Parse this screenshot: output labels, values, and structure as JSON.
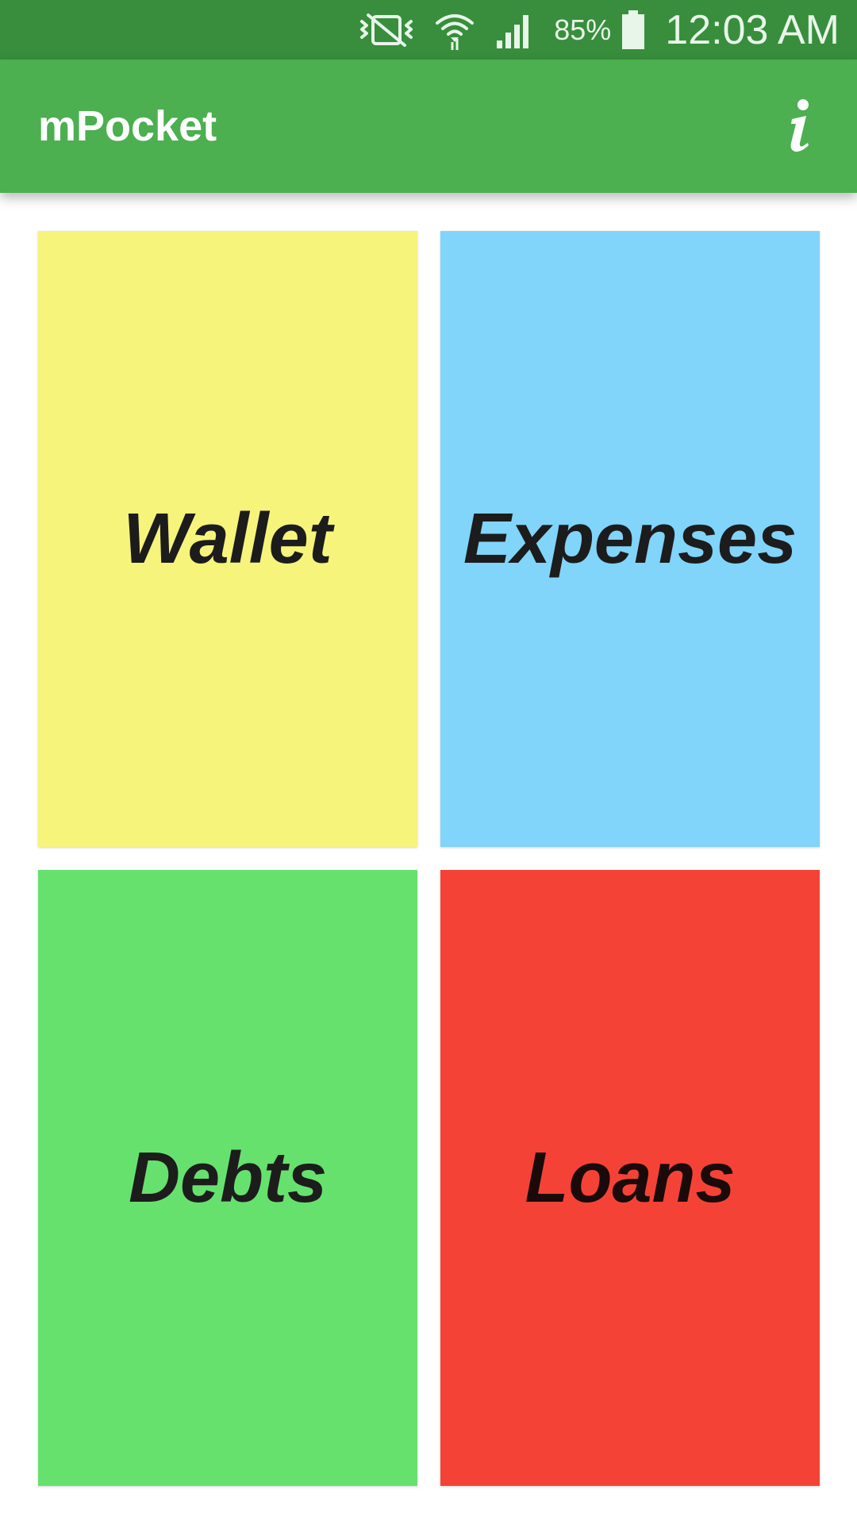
{
  "status_bar": {
    "icons": [
      "vibrate-mute-icon",
      "wifi-icon",
      "cell-signal-icon",
      "battery-icon"
    ],
    "battery_percent": "85%",
    "time": "12:03 AM"
  },
  "app_bar": {
    "title": "mPocket",
    "info_icon": "info-icon"
  },
  "tiles": [
    {
      "label": "Wallet",
      "color": "#f6f47a"
    },
    {
      "label": "Expenses",
      "color": "#81d4fa"
    },
    {
      "label": "Debts",
      "color": "#66e16e"
    },
    {
      "label": "Loans",
      "color": "#f44336"
    }
  ],
  "colors": {
    "status_bar": "#388e3c",
    "app_bar": "#4caf50",
    "background": "#ffffff"
  }
}
